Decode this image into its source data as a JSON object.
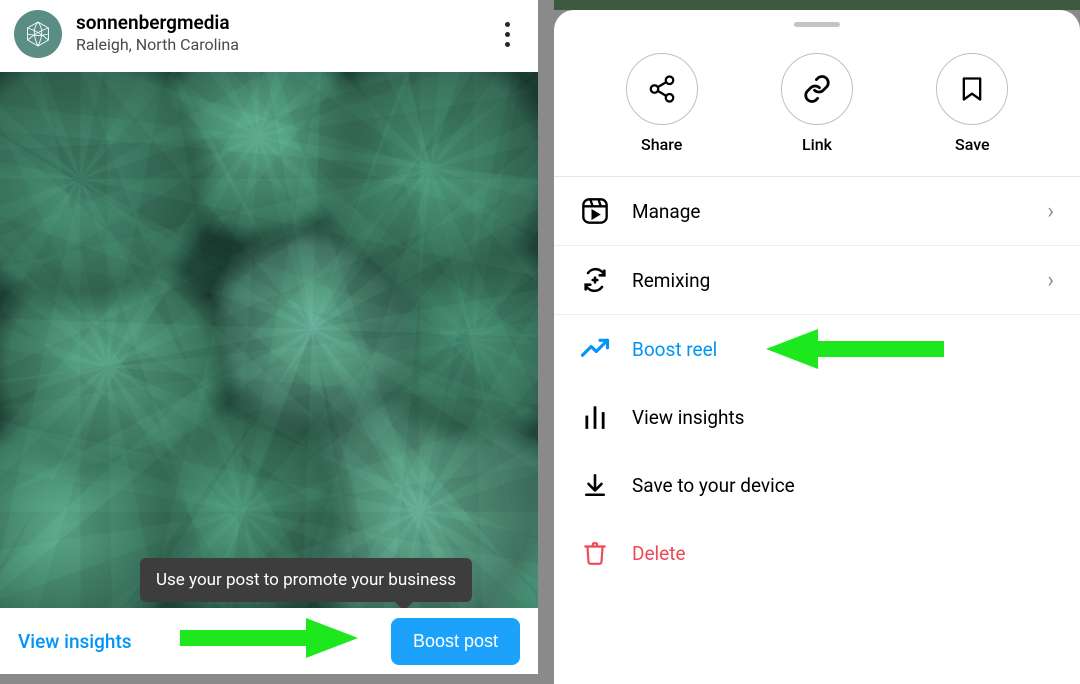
{
  "left": {
    "username": "sonnenbergmedia",
    "location": "Raleigh, North Carolina",
    "tooltip": "Use your post to promote your business",
    "view_insights": "View insights",
    "boost_post": "Boost post"
  },
  "right": {
    "actions": {
      "share": "Share",
      "link": "Link",
      "save": "Save"
    },
    "menu": {
      "manage": "Manage",
      "remixing": "Remixing",
      "boost_reel": "Boost reel",
      "view_insights": "View insights",
      "save_device": "Save to your device",
      "delete": "Delete"
    }
  },
  "colors": {
    "accent_blue": "#0095f6",
    "arrow_green": "#1de81d",
    "delete_red": "#ed4956"
  }
}
